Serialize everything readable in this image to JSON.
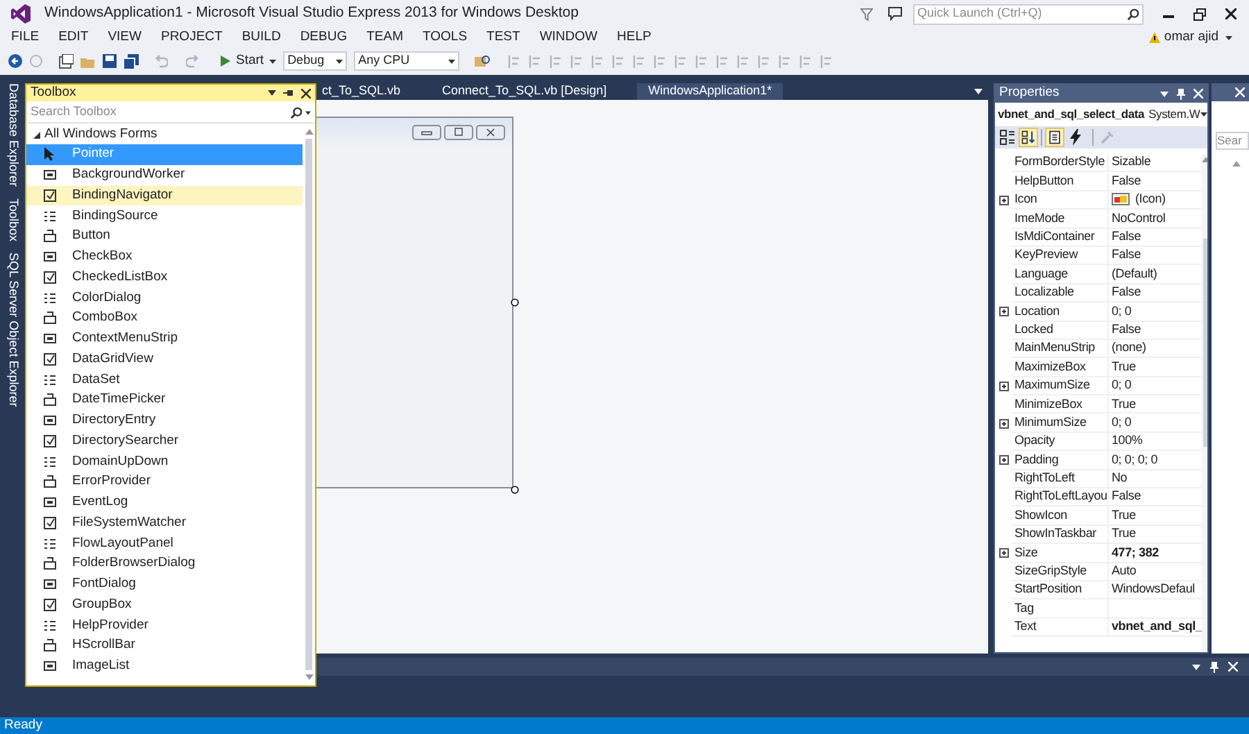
{
  "window": {
    "title": "WindowsApplication1 - Microsoft Visual Studio Express 2013 for Windows Desktop",
    "quick_launch": {
      "placeholder": "Quick Launch (Ctrl+Q)"
    },
    "user": "omar ajid"
  },
  "menu": [
    "FILE",
    "EDIT",
    "VIEW",
    "PROJECT",
    "BUILD",
    "DEBUG",
    "TEAM",
    "TOOLS",
    "TEST",
    "WINDOW",
    "HELP"
  ],
  "toolbar": {
    "start": "Start",
    "configuration": "Debug",
    "platform": "Any CPU"
  },
  "side_tabs": [
    "Database Explorer",
    "Toolbox",
    "SQL Server Object Explorer"
  ],
  "toolbox": {
    "title": "Toolbox",
    "search": {
      "placeholder": "Search Toolbox"
    },
    "group": {
      "label": "All Windows Forms",
      "expanded": true
    },
    "items": [
      {
        "label": "Pointer",
        "selected": true,
        "hovered": false
      },
      {
        "label": "BackgroundWorker",
        "selected": false,
        "hovered": false
      },
      {
        "label": "BindingNavigator",
        "selected": false,
        "hovered": true
      },
      {
        "label": "BindingSource",
        "selected": false,
        "hovered": false
      },
      {
        "label": "Button",
        "selected": false,
        "hovered": false
      },
      {
        "label": "CheckBox",
        "selected": false,
        "hovered": false
      },
      {
        "label": "CheckedListBox",
        "selected": false,
        "hovered": false
      },
      {
        "label": "ColorDialog",
        "selected": false,
        "hovered": false
      },
      {
        "label": "ComboBox",
        "selected": false,
        "hovered": false
      },
      {
        "label": "ContextMenuStrip",
        "selected": false,
        "hovered": false
      },
      {
        "label": "DataGridView",
        "selected": false,
        "hovered": false
      },
      {
        "label": "DataSet",
        "selected": false,
        "hovered": false
      },
      {
        "label": "DateTimePicker",
        "selected": false,
        "hovered": false
      },
      {
        "label": "DirectoryEntry",
        "selected": false,
        "hovered": false
      },
      {
        "label": "DirectorySearcher",
        "selected": false,
        "hovered": false
      },
      {
        "label": "DomainUpDown",
        "selected": false,
        "hovered": false
      },
      {
        "label": "ErrorProvider",
        "selected": false,
        "hovered": false
      },
      {
        "label": "EventLog",
        "selected": false,
        "hovered": false
      },
      {
        "label": "FileSystemWatcher",
        "selected": false,
        "hovered": false
      },
      {
        "label": "FlowLayoutPanel",
        "selected": false,
        "hovered": false
      },
      {
        "label": "FolderBrowserDialog",
        "selected": false,
        "hovered": false
      },
      {
        "label": "FontDialog",
        "selected": false,
        "hovered": false
      },
      {
        "label": "GroupBox",
        "selected": false,
        "hovered": false
      },
      {
        "label": "HelpProvider",
        "selected": false,
        "hovered": false
      },
      {
        "label": "HScrollBar",
        "selected": false,
        "hovered": false
      },
      {
        "label": "ImageList",
        "selected": false,
        "hovered": false
      }
    ]
  },
  "document_tabs": [
    {
      "label": "ct_To_SQL.vb",
      "selected": false
    },
    {
      "label": "Connect_To_SQL.vb [Design]",
      "selected": false
    },
    {
      "label": "WindowsApplication1*",
      "selected": true
    }
  ],
  "properties": {
    "title": "Properties",
    "object": "vbnet_and_sql_select_data",
    "object_type": "System.W",
    "rows": [
      {
        "name": "FormBorderStyle",
        "value": "Sizable",
        "kind": "text",
        "expandable": false,
        "modified": false
      },
      {
        "name": "HelpButton",
        "value": "False",
        "kind": "text",
        "expandable": false,
        "modified": false
      },
      {
        "name": "Icon",
        "value": "(Icon)",
        "kind": "image",
        "expandable": true,
        "modified": false
      },
      {
        "name": "ImeMode",
        "value": "NoControl",
        "kind": "text",
        "expandable": false,
        "modified": false
      },
      {
        "name": "IsMdiContainer",
        "value": "False",
        "kind": "text",
        "expandable": false,
        "modified": false
      },
      {
        "name": "KeyPreview",
        "value": "False",
        "kind": "text",
        "expandable": false,
        "modified": false
      },
      {
        "name": "Language",
        "value": "(Default)",
        "kind": "text",
        "expandable": false,
        "modified": false
      },
      {
        "name": "Localizable",
        "value": "False",
        "kind": "text",
        "expandable": false,
        "modified": false
      },
      {
        "name": "Location",
        "value": "0; 0",
        "kind": "text",
        "expandable": true,
        "modified": false
      },
      {
        "name": "Locked",
        "value": "False",
        "kind": "text",
        "expandable": false,
        "modified": false
      },
      {
        "name": "MainMenuStrip",
        "value": "(none)",
        "kind": "text",
        "expandable": false,
        "modified": false
      },
      {
        "name": "MaximizeBox",
        "value": "True",
        "kind": "text",
        "expandable": false,
        "modified": false
      },
      {
        "name": "MaximumSize",
        "value": "0; 0",
        "kind": "text",
        "expandable": true,
        "modified": false
      },
      {
        "name": "MinimizeBox",
        "value": "True",
        "kind": "text",
        "expandable": false,
        "modified": false
      },
      {
        "name": "MinimumSize",
        "value": "0; 0",
        "kind": "text",
        "expandable": true,
        "modified": false
      },
      {
        "name": "Opacity",
        "value": "100%",
        "kind": "text",
        "expandable": false,
        "modified": false
      },
      {
        "name": "Padding",
        "value": "0; 0; 0; 0",
        "kind": "text",
        "expandable": true,
        "modified": false
      },
      {
        "name": "RightToLeft",
        "value": "No",
        "kind": "text",
        "expandable": false,
        "modified": false
      },
      {
        "name": "RightToLeftLayou",
        "value": "False",
        "kind": "text",
        "expandable": false,
        "modified": false
      },
      {
        "name": "ShowIcon",
        "value": "True",
        "kind": "text",
        "expandable": false,
        "modified": false
      },
      {
        "name": "ShowInTaskbar",
        "value": "True",
        "kind": "text",
        "expandable": false,
        "modified": false
      },
      {
        "name": "Size",
        "value": "477; 382",
        "kind": "text",
        "expandable": true,
        "modified": true
      },
      {
        "name": "SizeGripStyle",
        "value": "Auto",
        "kind": "text",
        "expandable": false,
        "modified": false
      },
      {
        "name": "StartPosition",
        "value": "WindowsDefaul",
        "kind": "text",
        "expandable": false,
        "modified": false
      },
      {
        "name": "Tag",
        "kind": "text",
        "expandable": false,
        "modified": false
      },
      {
        "name": "Text",
        "value": "vbnet_and_sql_",
        "kind": "text",
        "expandable": false,
        "modified": true
      }
    ]
  },
  "side_panel": {
    "search": {
      "placeholder": "Sear"
    }
  },
  "status_bar": "Ready"
}
